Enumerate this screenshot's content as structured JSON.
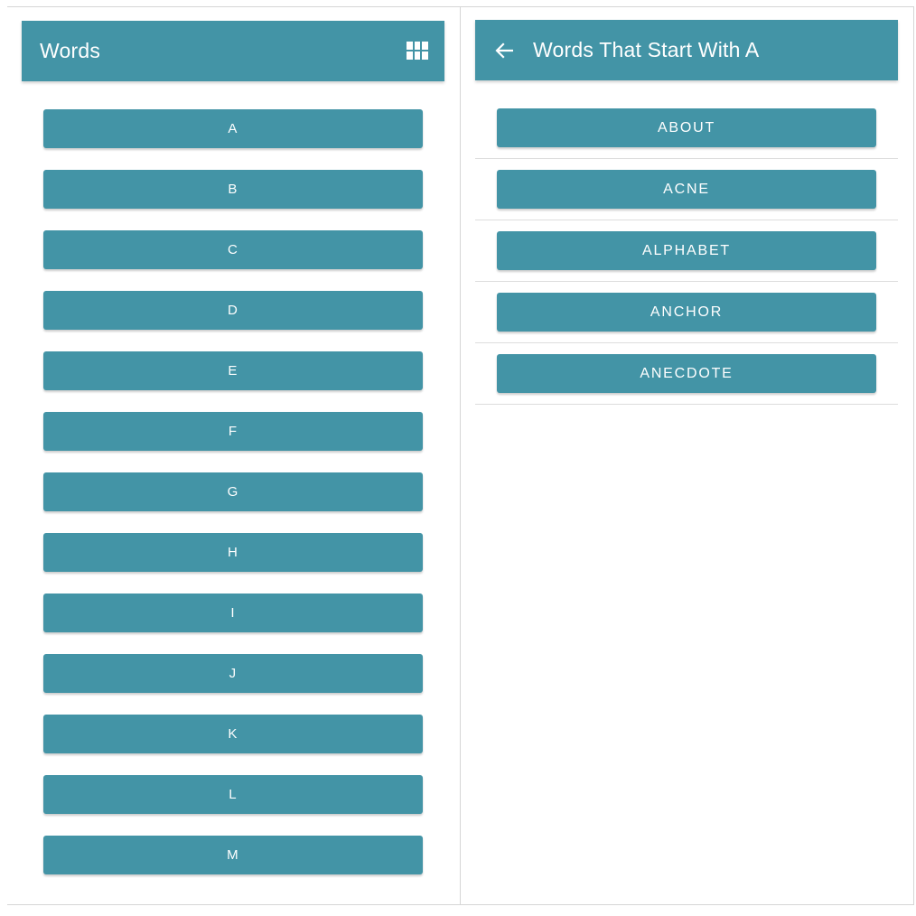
{
  "left_screen": {
    "title": "Words",
    "grid_icon": "grid-view-icon",
    "letters": [
      "A",
      "B",
      "C",
      "D",
      "E",
      "F",
      "G",
      "H",
      "I",
      "J",
      "K",
      "L",
      "M"
    ]
  },
  "right_screen": {
    "back_icon": "arrow-back-icon",
    "title": "Words That Start With A",
    "words": [
      "ABOUT",
      "ACNE",
      "ALPHABET",
      "ANCHOR",
      "ANECDOTE"
    ]
  },
  "colors": {
    "accent": "#4394a6",
    "text_on_accent": "#ffffff",
    "divider": "#dddddd"
  }
}
